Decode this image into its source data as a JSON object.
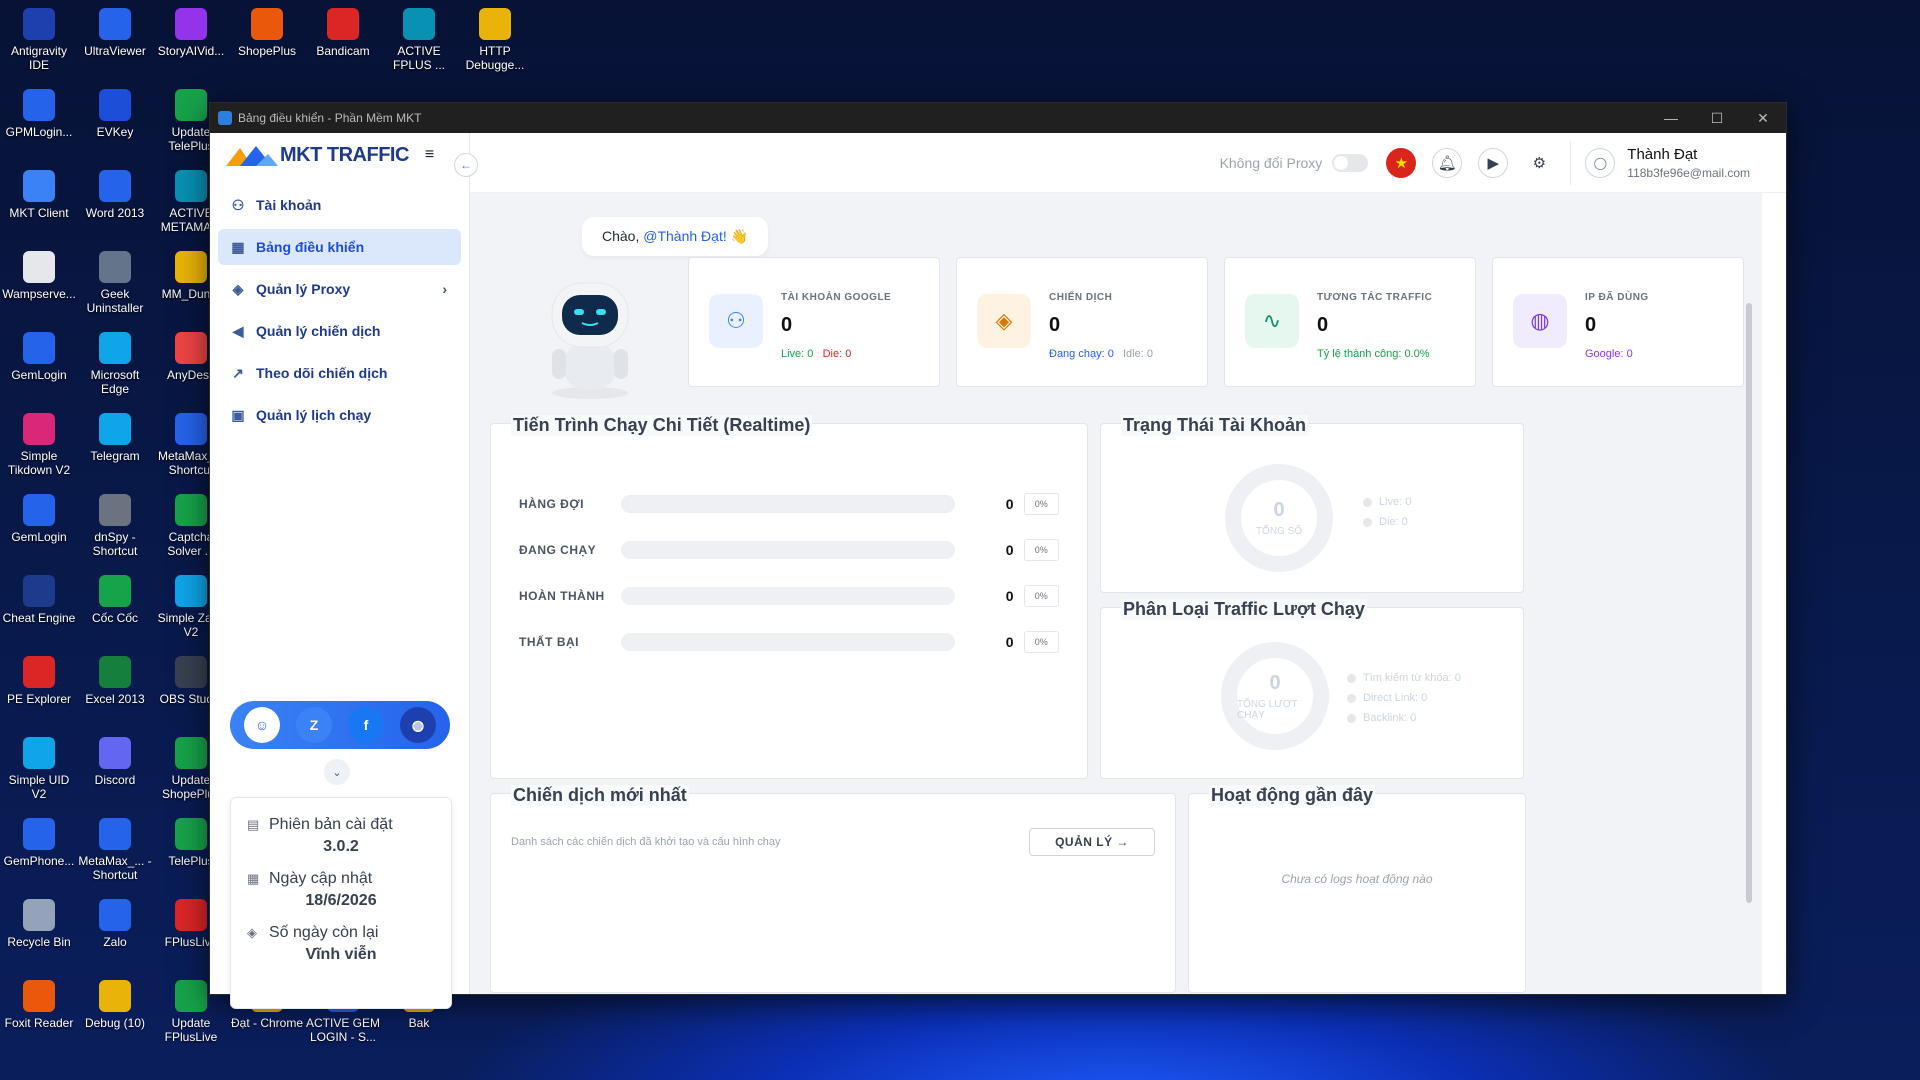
{
  "desktop": {
    "icons": [
      {
        "label": "Antigravity IDE",
        "col": 0,
        "row": 0,
        "color": "#1e40af"
      },
      {
        "label": "UltraViewer",
        "col": 1,
        "row": 0,
        "color": "#2563eb"
      },
      {
        "label": "StoryAIVid...",
        "col": 2,
        "row": 0,
        "color": "#9333ea"
      },
      {
        "label": "ShopePlus",
        "col": 3,
        "row": 0,
        "color": "#ea580c"
      },
      {
        "label": "Bandicam",
        "col": 4,
        "row": 0,
        "color": "#dc2626"
      },
      {
        "label": "ACTIVE FPLUS ...",
        "col": 5,
        "row": 0,
        "color": "#0891b2"
      },
      {
        "label": "HTTP Debugge...",
        "col": 6,
        "row": 0,
        "color": "#eab308"
      },
      {
        "label": "GPMLogin...",
        "col": 0,
        "row": 1,
        "color": "#2563eb"
      },
      {
        "label": "EVKey",
        "col": 1,
        "row": 1,
        "color": "#1d4ed8"
      },
      {
        "label": "Update TelePlus",
        "col": 2,
        "row": 1,
        "color": "#16a34a"
      },
      {
        "label": "MKT Client",
        "col": 0,
        "row": 2,
        "color": "#3b82f6"
      },
      {
        "label": "Word 2013",
        "col": 1,
        "row": 2,
        "color": "#2563eb"
      },
      {
        "label": "ACTIVE METAMA...",
        "col": 2,
        "row": 2,
        "color": "#0891b2"
      },
      {
        "label": "Wampserve...",
        "col": 0,
        "row": 3,
        "color": "#e5e7eb"
      },
      {
        "label": "Geek Uninstaller",
        "col": 1,
        "row": 3,
        "color": "#64748b"
      },
      {
        "label": "MM_Dun...",
        "col": 2,
        "row": 3,
        "color": "#eab308"
      },
      {
        "label": "GemLogin",
        "col": 0,
        "row": 4,
        "color": "#2563eb"
      },
      {
        "label": "Microsoft Edge",
        "col": 1,
        "row": 4,
        "color": "#0ea5e9"
      },
      {
        "label": "AnyDesk",
        "col": 2,
        "row": 4,
        "color": "#ef4444"
      },
      {
        "label": "Simple Tikdown V2",
        "col": 0,
        "row": 5,
        "color": "#db2777"
      },
      {
        "label": "Telegram",
        "col": 1,
        "row": 5,
        "color": "#0ea5e9"
      },
      {
        "label": "MetaMax_... Shortcut",
        "col": 2,
        "row": 5,
        "color": "#2563eb"
      },
      {
        "label": "GemLogin",
        "col": 0,
        "row": 6,
        "color": "#2563eb"
      },
      {
        "label": "dnSpy - Shortcut",
        "col": 1,
        "row": 6,
        "color": "#6b7280"
      },
      {
        "label": "Captcha Solver ...",
        "col": 2,
        "row": 6,
        "color": "#16a34a"
      },
      {
        "label": "Cheat Engine",
        "col": 0,
        "row": 7,
        "color": "#1e3a8a"
      },
      {
        "label": "Cốc Cốc",
        "col": 1,
        "row": 7,
        "color": "#16a34a"
      },
      {
        "label": "Simple Zal... V2",
        "col": 2,
        "row": 7,
        "color": "#0ea5e9"
      },
      {
        "label": "PE Explorer",
        "col": 0,
        "row": 8,
        "color": "#dc2626"
      },
      {
        "label": "Excel 2013",
        "col": 1,
        "row": 8,
        "color": "#15803d"
      },
      {
        "label": "OBS Studio",
        "col": 2,
        "row": 8,
        "color": "#374151"
      },
      {
        "label": "Simple UID V2",
        "col": 0,
        "row": 9,
        "color": "#0ea5e9"
      },
      {
        "label": "Discord",
        "col": 1,
        "row": 9,
        "color": "#6366f1"
      },
      {
        "label": "Update ShopePlus",
        "col": 2,
        "row": 9,
        "color": "#16a34a"
      },
      {
        "label": "GemPhone...",
        "col": 0,
        "row": 10,
        "color": "#2563eb"
      },
      {
        "label": "MetaMax_... - Shortcut",
        "col": 1,
        "row": 10,
        "color": "#2563eb"
      },
      {
        "label": "TelePlus",
        "col": 2,
        "row": 10,
        "color": "#16a34a"
      },
      {
        "label": "Recycle Bin",
        "col": 0,
        "row": 11,
        "color": "#94a3b8"
      },
      {
        "label": "Zalo",
        "col": 1,
        "row": 11,
        "color": "#2563eb"
      },
      {
        "label": "FPlusLive",
        "col": 2,
        "row": 11,
        "color": "#dc2626"
      },
      {
        "label": "Foxit Reader",
        "col": 0,
        "row": 12,
        "color": "#ea580c"
      },
      {
        "label": "Debug (10)",
        "col": 1,
        "row": 12,
        "color": "#eab308"
      },
      {
        "label": "Update FPlusLive",
        "col": 2,
        "row": 12,
        "color": "#16a34a"
      },
      {
        "label": "Đạt - Chrome",
        "col": 3,
        "row": 12,
        "color": "#eab308"
      },
      {
        "label": "ACTIVE GEM LOGIN - S...",
        "col": 4,
        "row": 12,
        "color": "#2563eb"
      },
      {
        "label": "Bak",
        "col": 5,
        "row": 12,
        "color": "#eab308"
      }
    ]
  },
  "window": {
    "title": "Bảng điều khiển - Phần Mềm MKT"
  },
  "app": {
    "logo": "MKT TRAFFIC"
  },
  "sidebar": {
    "items": [
      {
        "label": "Tài khoản",
        "icon": "users-icon",
        "active": false
      },
      {
        "label": "Bảng điều khiển",
        "icon": "dashboard-icon",
        "active": true
      },
      {
        "label": "Quản lý Proxy",
        "icon": "layers-icon",
        "active": false,
        "chevron": true
      },
      {
        "label": "Quản lý chiến dịch",
        "icon": "megaphone-icon",
        "active": false
      },
      {
        "label": "Theo dõi chiến dịch",
        "icon": "chart-icon",
        "active": false
      },
      {
        "label": "Quản lý lịch chạy",
        "icon": "calendar-icon",
        "active": false
      }
    ]
  },
  "info": {
    "version_label": "Phiên bản cài đặt",
    "version": "3.0.2",
    "updated_label": "Ngày cập nhật",
    "updated": "18/6/2026",
    "days_label": "Số ngày còn lại",
    "days": "Vĩnh viễn"
  },
  "topbar": {
    "proxy_label": "Không đổi Proxy",
    "user_name": "Thành Đạt",
    "user_email": "118b3fe96e@mail.com"
  },
  "greeting": {
    "prefix": "Chào, ",
    "user": "@Thành Đạt!",
    "emoji": "👋"
  },
  "stats": [
    {
      "title": "TÀI KHOẢN GOOGLE",
      "value": "0",
      "sub1": "Live: 0",
      "sub1_color": "#16a34a",
      "sub2": "Die: 0",
      "sub2_color": "#dc2626",
      "accent": "#3b82f6",
      "bg": "#eaf1fe"
    },
    {
      "title": "CHIẾN DỊCH",
      "value": "0",
      "sub1": "Đang chạy: 0",
      "sub1_color": "#2563eb",
      "sub2": "Idle: 0",
      "sub2_color": "#9ca3af",
      "accent": "#d97706",
      "bg": "#fef3e2"
    },
    {
      "title": "TƯƠNG TÁC TRAFFIC",
      "value": "0",
      "sub1": "Tỷ lệ thành công: 0.0%",
      "sub1_color": "#16a34a",
      "sub2": "",
      "sub2_color": "#9ca3af",
      "accent": "#059669",
      "bg": "#e6f7ef"
    },
    {
      "title": "IP ĐÃ DÙNG",
      "value": "0",
      "sub1": "Google: 0",
      "sub1_color": "#9333ea",
      "sub2": "",
      "sub2_color": "#9ca3af",
      "accent": "#7c3aed",
      "bg": "#f1ebfe"
    }
  ],
  "progress": {
    "title": "Tiến Trình Chạy Chi Tiết (Realtime)",
    "rows": [
      {
        "label": "HÀNG ĐỢI",
        "count": "0",
        "pct": "0%"
      },
      {
        "label": "ĐANG CHẠY",
        "count": "0",
        "pct": "0%"
      },
      {
        "label": "HOÀN THÀNH",
        "count": "0",
        "pct": "0%"
      },
      {
        "label": "THẤT BẠI",
        "count": "0",
        "pct": "0%"
      }
    ]
  },
  "account_status": {
    "title": "Trạng Thái Tài Khoản",
    "total": "0",
    "total_label": "TỔNG SỐ",
    "legend": [
      "Live: 0",
      "Die: 0"
    ]
  },
  "traffic_type": {
    "title": "Phân Loại Traffic Lượt Chạy",
    "total": "0",
    "total_label": "TỔNG LƯỢT CHẠY",
    "legend": [
      "Tìm kiếm từ khóa: 0",
      "Direct Link: 0",
      "Backlink: 0"
    ]
  },
  "campaigns": {
    "title": "Chiến dịch mới nhất",
    "subtitle": "Danh sách các chiến dịch đã khởi tạo và cấu hình chạy",
    "button": "QUẢN LÝ →"
  },
  "activity": {
    "title": "Hoạt động gần đây",
    "empty": "Chưa có logs hoạt động nào"
  }
}
